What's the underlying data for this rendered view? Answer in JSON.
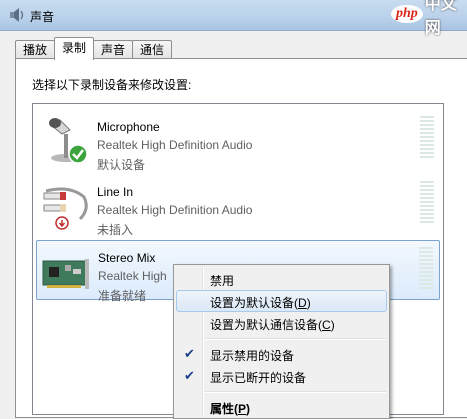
{
  "window": {
    "title": "声音"
  },
  "watermark": {
    "php": "php",
    "cn": "中文网"
  },
  "tabs": [
    {
      "label": "播放"
    },
    {
      "label": "录制"
    },
    {
      "label": "声音"
    },
    {
      "label": "通信"
    }
  ],
  "instruction": "选择以下录制设备来修改设置:",
  "devices": [
    {
      "name": "Microphone",
      "driver": "Realtek High Definition Audio",
      "status": "默认设备"
    },
    {
      "name": "Line In",
      "driver": "Realtek High Definition Audio",
      "status": "未插入"
    },
    {
      "name": "Stereo Mix",
      "driver": "Realtek High",
      "status": "准备就绪"
    }
  ],
  "context_menu": {
    "items": [
      {
        "label": "禁用"
      },
      {
        "label": "设置为默认设备",
        "accel": "D"
      },
      {
        "label": "设置为默认通信设备",
        "accel": "C"
      },
      {
        "label": "显示禁用的设备",
        "checked": true
      },
      {
        "label": "显示已断开的设备",
        "checked": true
      },
      {
        "label": "属性",
        "accel": "P"
      }
    ]
  },
  "colors": {
    "selection_border": "#7da2ce",
    "menu_hover": "#a8c8ec",
    "check": "#1d3f8c"
  }
}
